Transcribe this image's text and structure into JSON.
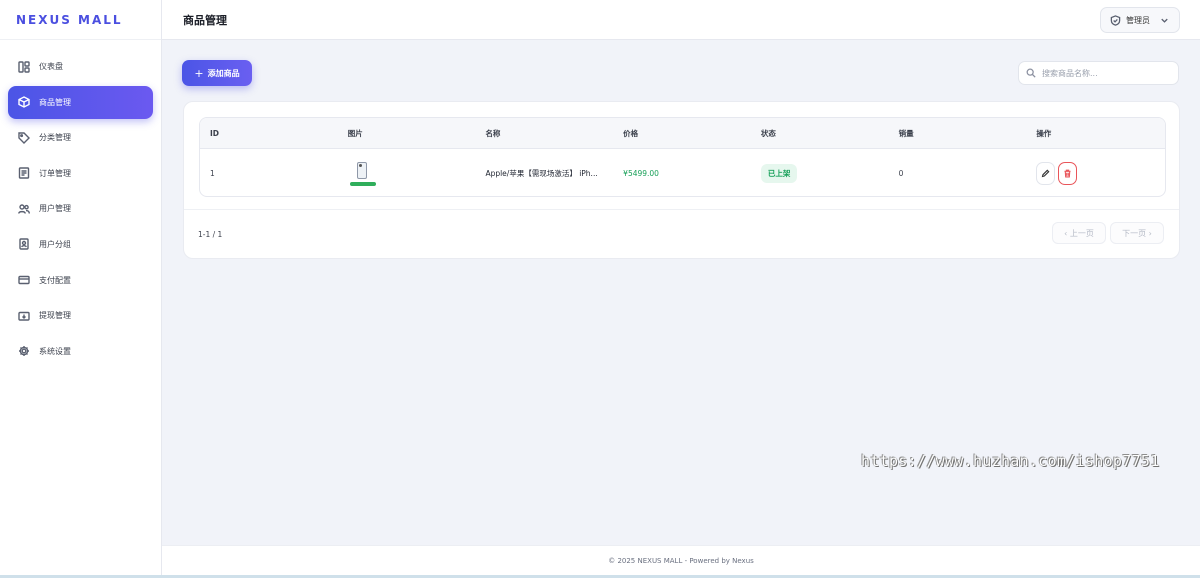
{
  "brand": "NEXUS MALL",
  "sidebar": {
    "items": [
      {
        "label": "仪表盘",
        "icon": "dashboard-icon",
        "active": false
      },
      {
        "label": "商品管理",
        "icon": "box-icon",
        "active": true
      },
      {
        "label": "分类管理",
        "icon": "tag-icon",
        "active": false
      },
      {
        "label": "订单管理",
        "icon": "receipt-icon",
        "active": false
      },
      {
        "label": "用户管理",
        "icon": "users-icon",
        "active": false
      },
      {
        "label": "用户分组",
        "icon": "user-badge-icon",
        "active": false
      },
      {
        "label": "支付配置",
        "icon": "credit-card-icon",
        "active": false
      },
      {
        "label": "提现管理",
        "icon": "wallet-icon",
        "active": false
      },
      {
        "label": "系统设置",
        "icon": "gear-icon",
        "active": false
      }
    ]
  },
  "header": {
    "title": "商品管理",
    "admin_label": "管理员"
  },
  "toolbar": {
    "add_label": "添加商品",
    "search_placeholder": "搜索商品名称..."
  },
  "table": {
    "columns": [
      "ID",
      "图片",
      "名称",
      "价格",
      "状态",
      "销量",
      "操作"
    ],
    "rows": [
      {
        "id": "1",
        "name": "Apple/苹果【需现场激活】 iPh...",
        "price": "¥5499.00",
        "status": "已上架",
        "sales": "0"
      }
    ]
  },
  "pagination": {
    "info": "1-1 / 1",
    "prev_label": "上一页",
    "next_label": "下一页"
  },
  "footer": {
    "text": "© 2025 NEXUS MALL - Powered by Nexus"
  },
  "watermark": "https://www.huzhan.com/ishop7751",
  "colors": {
    "accent": "#4b55e6",
    "price": "#18a058",
    "status_bg": "#e6f7ee",
    "delete": "#e9555a"
  }
}
